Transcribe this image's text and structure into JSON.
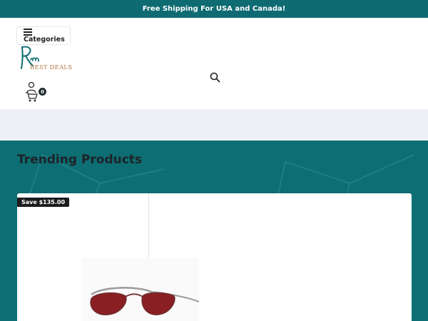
{
  "announcement": {
    "text": "Free Shipping For USA and Canada!"
  },
  "header": {
    "categories_label": "Categories",
    "logo": {
      "monogram": "Rm",
      "text": "BEST DEALS"
    },
    "cart": {
      "count": "0"
    }
  },
  "trending": {
    "title": "Trending Products",
    "products": [
      {
        "badge": "Save $135.00"
      }
    ]
  },
  "colors": {
    "brand_teal": "#0e6b72",
    "logo_gold": "#b07a44",
    "badge_bg": "#1c1c1c",
    "strip_bg": "#eef0f6"
  },
  "icons": [
    "menu-icon",
    "search-icon",
    "user-icon",
    "cart-icon"
  ]
}
